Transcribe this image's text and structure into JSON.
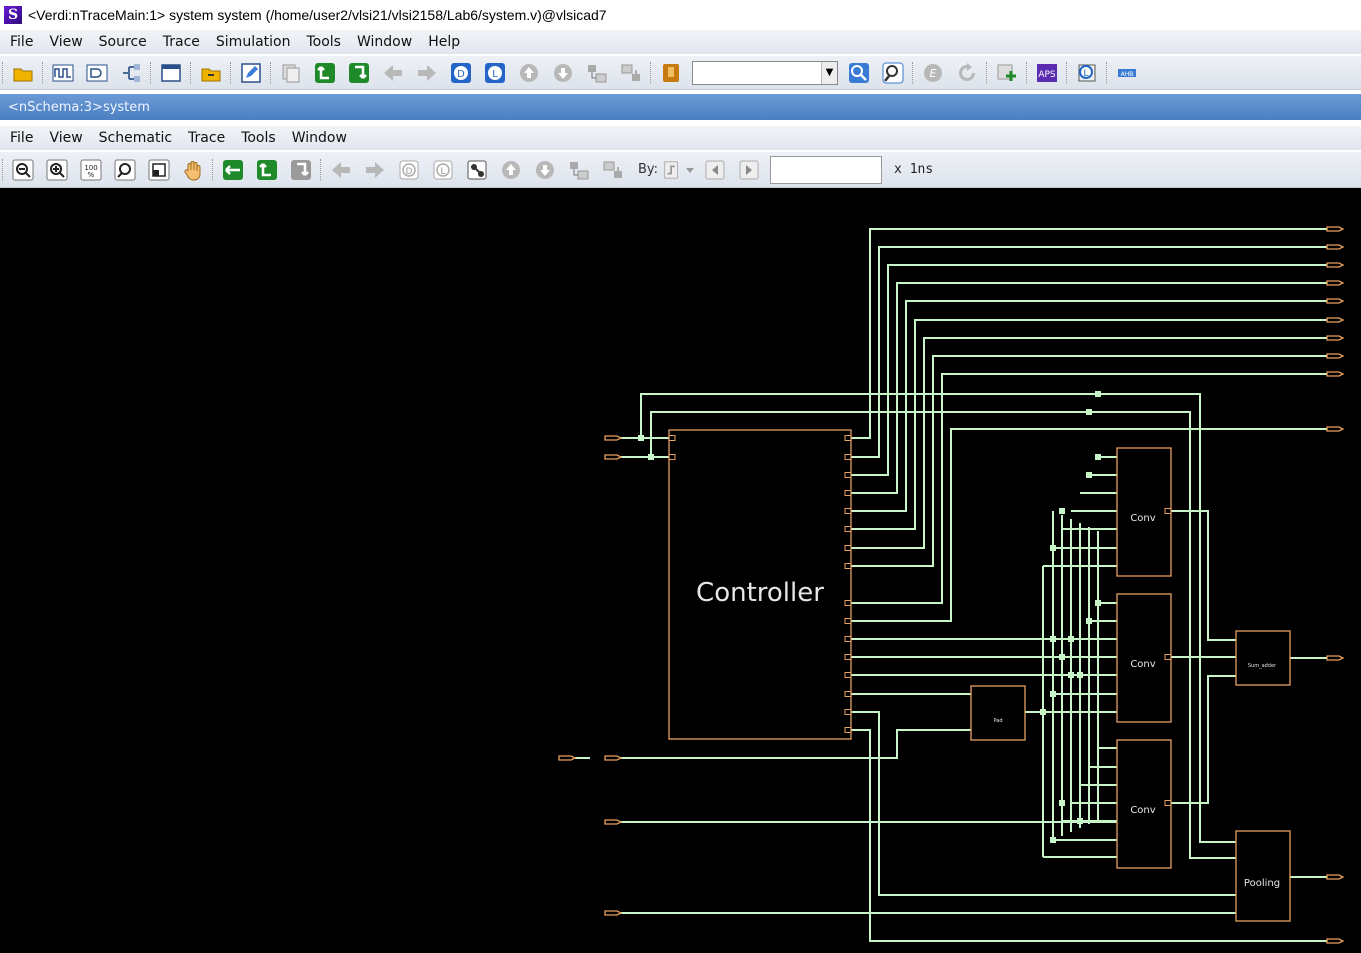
{
  "window": {
    "title": "<Verdi:nTraceMain:1> system system (/home/user2/vlsi21/vlsi2158/Lab6/system.v)@vlsicad7",
    "logo": "S"
  },
  "main_menu": [
    {
      "label": "File"
    },
    {
      "label": "View"
    },
    {
      "label": "Source"
    },
    {
      "label": "Trace"
    },
    {
      "label": "Simulation"
    },
    {
      "label": "Tools"
    },
    {
      "label": "Window"
    },
    {
      "label": "Help"
    }
  ],
  "main_toolbar": {
    "search_value": "",
    "icons": [
      "open-folder-icon",
      "waveform-icon",
      "signal-list-icon",
      "hierarchy-icon",
      "window-icon",
      "open-source-icon",
      "edit-icon",
      "copy-icon",
      "trace-up-icon",
      "trace-down-icon",
      "back-arrow-icon",
      "forward-arrow-icon",
      "driver-icon",
      "load-icon",
      "up-icon",
      "down-icon",
      "expand-icon",
      "collapse-icon",
      "bookmark-icon",
      "search-icon",
      "find-icon",
      "e-icon",
      "refresh-icon",
      "add-icon",
      "apps-icon",
      "l-icon",
      "ahb-icon"
    ]
  },
  "schematic": {
    "tab_title": "<nSchema:3>system",
    "menu": [
      {
        "label": "File"
      },
      {
        "label": "View"
      },
      {
        "label": "Schematic"
      },
      {
        "label": "Trace"
      },
      {
        "label": "Tools"
      },
      {
        "label": "Window"
      }
    ],
    "toolbar": {
      "by_label": "By:",
      "time_value": "",
      "time_unit": "x 1ns"
    },
    "blocks": [
      {
        "id": "controller",
        "label": "Controller"
      },
      {
        "id": "conv1",
        "label": "Conv"
      },
      {
        "id": "conv2",
        "label": "Conv"
      },
      {
        "id": "conv3",
        "label": "Conv"
      },
      {
        "id": "pad",
        "label": "Pad"
      },
      {
        "id": "sum",
        "label": "Sum_adder"
      },
      {
        "id": "pool",
        "label": "Pooling"
      }
    ],
    "colors": {
      "wire": "#c8f5c8",
      "block": "#e8a060",
      "background": "#000000",
      "label": "#e6e6e6"
    }
  }
}
